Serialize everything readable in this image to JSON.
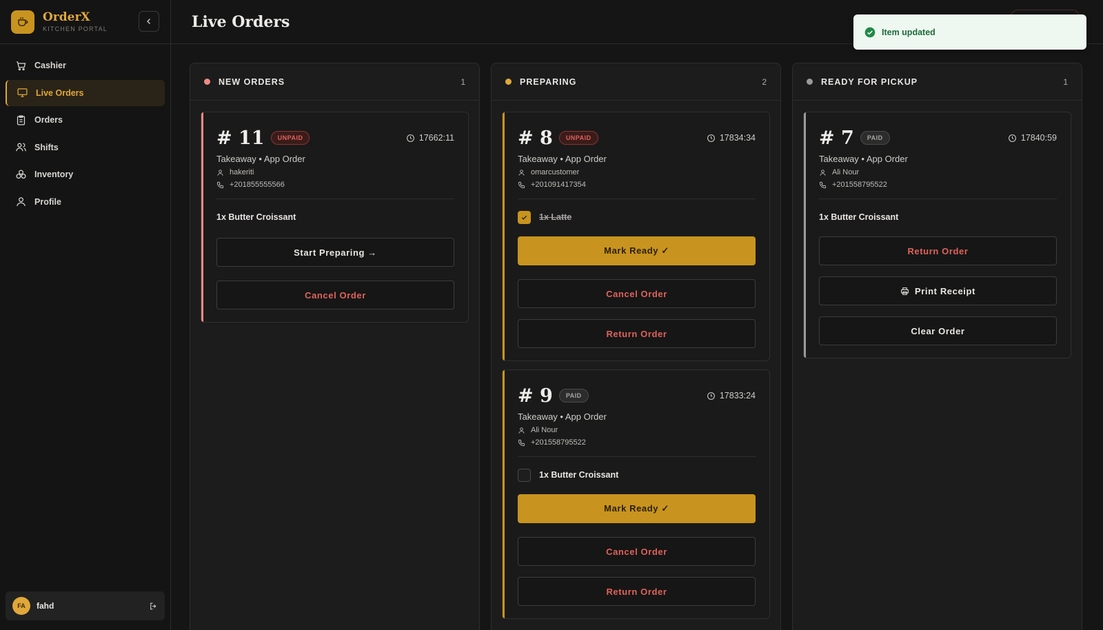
{
  "brand": {
    "name": "OrderX",
    "subtitle": "KITCHEN PORTAL"
  },
  "nav": [
    {
      "label": "Cashier",
      "icon": "cart-icon"
    },
    {
      "label": "Live Orders",
      "icon": "monitor-icon",
      "active": true
    },
    {
      "label": "Orders",
      "icon": "clipboard-icon"
    },
    {
      "label": "Shifts",
      "icon": "users-icon"
    },
    {
      "label": "Inventory",
      "icon": "boxes-icon"
    },
    {
      "label": "Profile",
      "icon": "user-icon"
    }
  ],
  "user": {
    "initials": "FA",
    "name": "fahd"
  },
  "header": {
    "title": "Live Orders"
  },
  "toast": {
    "message": "Item updated"
  },
  "columns": [
    {
      "title": "NEW ORDERS",
      "count": "1",
      "dot_color": "#f08a86"
    },
    {
      "title": "PREPARING",
      "count": "2",
      "dot_color": "#e0a83a"
    },
    {
      "title": "READY FOR PICKUP",
      "count": "1",
      "dot_color": "#9a9a9a"
    }
  ],
  "orders": {
    "o11": {
      "number": "# 11",
      "badge": "UNPAID",
      "time": "17662:11",
      "type": "Takeaway • App Order",
      "customer": "hakeriti",
      "phone": "+201855555566",
      "item": "1x Butter Croissant",
      "primary": "Start Preparing →",
      "cancel": "Cancel Order"
    },
    "o8": {
      "number": "# 8",
      "badge": "UNPAID",
      "time": "17834:34",
      "type": "Takeaway • App Order",
      "customer": "omarcustomer",
      "phone": "+201091417354",
      "item": "1x Latte",
      "item_checked": true,
      "primary": "Mark Ready ✓",
      "cancel": "Cancel Order",
      "return": "Return Order"
    },
    "o9": {
      "number": "# 9",
      "badge": "PAID",
      "time": "17833:24",
      "type": "Takeaway • App Order",
      "customer": "Ali Nour",
      "phone": "+201558795522",
      "item": "1x Butter Croissant",
      "item_checked": false,
      "primary": "Mark Ready ✓",
      "cancel": "Cancel Order",
      "return": "Return Order"
    },
    "o7": {
      "number": "# 7",
      "badge": "PAID",
      "time": "17840:59",
      "type": "Takeaway • App Order",
      "customer": "Ali Nour",
      "phone": "+201558795522",
      "item": "1x Butter Croissant",
      "return": "Return Order",
      "print": "Print Receipt",
      "clear": "Clear Order"
    }
  },
  "colors": {
    "accent": "#c8941f",
    "danger": "#e0625a",
    "new": "#f08a86",
    "ready": "#9a9a9a"
  }
}
